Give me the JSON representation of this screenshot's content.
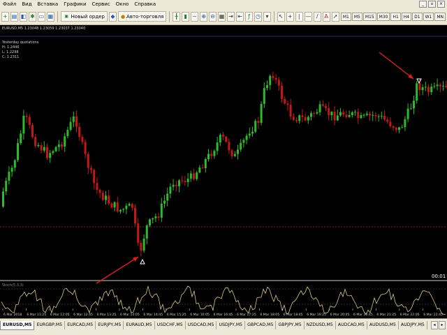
{
  "menu": {
    "items": [
      "Файл",
      "Вид",
      "Вставка",
      "Графики",
      "Сервис",
      "Окно",
      "Справка"
    ]
  },
  "toolbar": {
    "new_order_label": "Новый ордер",
    "autotrade_label": "Авто-торговля",
    "timeframes": [
      "M1",
      "M5",
      "M15",
      "M30",
      "H1",
      "H4",
      "D1",
      "W1",
      "MN"
    ]
  },
  "chart": {
    "header": "EURUSD,M5  1.23048 1.23059 1.23037 1.23040",
    "indicator_name": "Yesterday quotations",
    "indicator_lines": [
      "H: 1.2446",
      "L: 1.2298",
      "C: 1.2311"
    ],
    "countdown": "00:01",
    "oscillator_label": "Stoch(5,3,3)",
    "colors": {
      "bull": "#2dbb2d",
      "bear": "#c41818",
      "level": "#8b1a1a",
      "arrow": "#e02020",
      "osc": "#d8c98a",
      "axis": "#cfcfcf"
    }
  },
  "chart_data": {
    "type": "candlestick",
    "symbol": "EURUSD,M5",
    "time_labels": [
      "6 Mar 2018",
      "6 Mar 11:25",
      "6 Mar 12:05",
      "6 Mar 12:45",
      "6 Mar 13:25",
      "6 Mar 14:05",
      "6 Mar 14:45",
      "6 Mar 15:25",
      "6 Mar 16:05",
      "6 Mar 16:45",
      "6 Mar 17:25",
      "6 Mar 18:05",
      "6 Mar 18:45",
      "6 Mar 19:25",
      "6 Mar 20:05",
      "6 Mar 20:45",
      "6 Mar 21:25",
      "6 Mar 22:05",
      "6 Mar 22:45"
    ],
    "indicator": "Stochastic oscillator"
  },
  "tabs": [
    "EURUSD,M5",
    "EURGBP,M5",
    "EURCAD,M5",
    "EURJPY,M5",
    "EURAUD,M5",
    "USDCHF,M5",
    "USDCAD,M5",
    "USDJPY,M5",
    "GBPCAD,M5",
    "GBPJPY,M5",
    "NZDUSD,M5",
    "AUDCAD,M5",
    "AUDUSD,M5",
    "AUDJPY,M5"
  ]
}
